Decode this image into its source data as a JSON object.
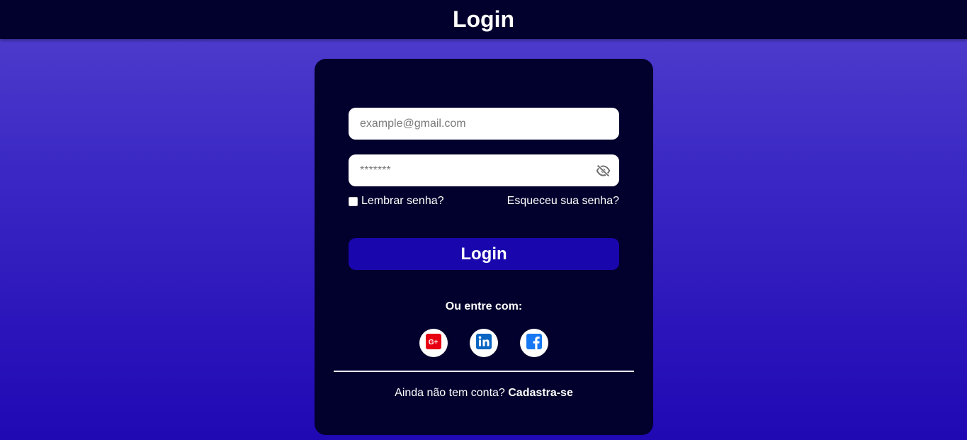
{
  "header": {
    "title": "Login"
  },
  "form": {
    "email": {
      "value": "",
      "placeholder": "example@gmail.com"
    },
    "password": {
      "value": "",
      "placeholder": "*******",
      "toggle_icon": "eye-slash-icon"
    },
    "remember_label": "Lembrar senha?",
    "remember_checked": false,
    "forgot_label": "Esqueceu sua senha?",
    "submit_label": "Login"
  },
  "social": {
    "label": "Ou entre com:",
    "providers": [
      {
        "name": "Google Plus",
        "icon": "google-plus-icon",
        "color": "#e60012"
      },
      {
        "name": "LinkedIn",
        "icon": "linkedin-icon",
        "color": "#0a66c2"
      },
      {
        "name": "Facebook",
        "icon": "facebook-icon",
        "color": "#1877f2"
      }
    ]
  },
  "signup": {
    "prompt": "Ainda não tem conta?",
    "link_label": "Cadastra-se"
  },
  "colors": {
    "header_bg": "#02002c",
    "card_bg": "#02002c",
    "button_bg": "#1a06ad",
    "page_gradient_top": "#5140cd",
    "page_gradient_bottom": "#2008b3"
  }
}
